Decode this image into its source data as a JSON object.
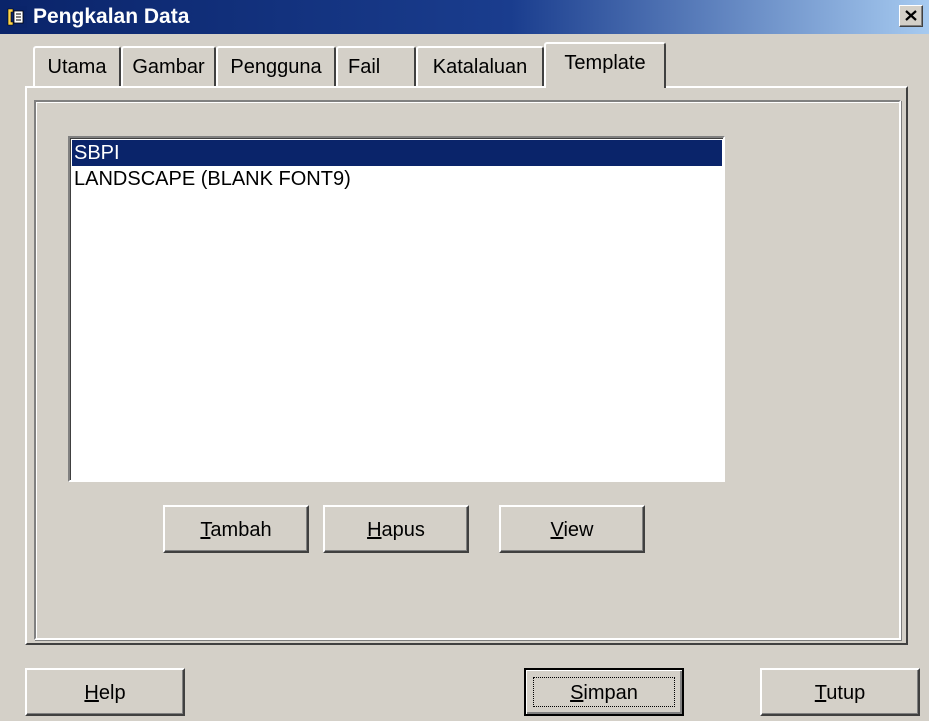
{
  "window": {
    "title": "Pengkalan Data",
    "close_label": "×"
  },
  "tabs": [
    {
      "label": "Utama"
    },
    {
      "label": "Gambar"
    },
    {
      "label": "Pengguna"
    },
    {
      "label": "Fail"
    },
    {
      "label": "Katalaluan"
    },
    {
      "label": "Template",
      "active": true
    }
  ],
  "template_list": {
    "items": [
      {
        "label": "SBPI",
        "selected": true
      },
      {
        "label": "LANDSCAPE (BLANK FONT9)",
        "selected": false
      }
    ]
  },
  "buttons": {
    "tambah": {
      "mnemonic": "T",
      "rest": "ambah"
    },
    "hapus": {
      "mnemonic": "H",
      "rest": "apus"
    },
    "view": {
      "mnemonic": "V",
      "rest": "iew"
    },
    "help": {
      "mnemonic": "H",
      "rest": "elp"
    },
    "simpan": {
      "mnemonic": "S",
      "rest": "impan"
    },
    "tutup": {
      "mnemonic": "T",
      "rest": "utup"
    }
  },
  "colors": {
    "face": "#d4d0c8",
    "title_start": "#0a246a",
    "title_end": "#a6caf0",
    "selection": "#0a246a"
  },
  "icons": {
    "app": "database-app-icon",
    "close": "close-icon"
  }
}
